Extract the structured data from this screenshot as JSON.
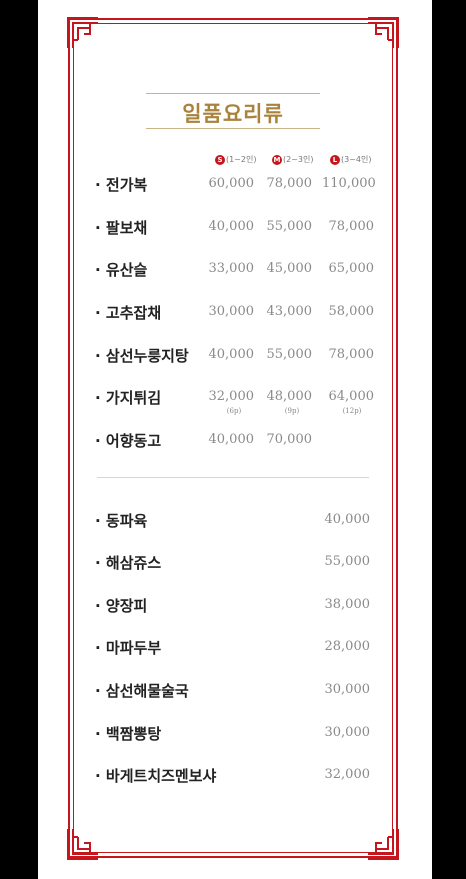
{
  "title": "일품요리류",
  "size_headers": [
    {
      "badge": "S",
      "text": "(1~2인)"
    },
    {
      "badge": "M",
      "text": "(2~3인)"
    },
    {
      "badge": "L",
      "text": "(3~4인)"
    }
  ],
  "sized_dishes": [
    {
      "name": "· 전가복",
      "s": "60,000",
      "m": "78,000",
      "l": "110,000"
    },
    {
      "name": "· 팔보채",
      "s": "40,000",
      "m": "55,000",
      "l": "78,000"
    },
    {
      "name": "· 유산슬",
      "s": "33,000",
      "m": "45,000",
      "l": "65,000"
    },
    {
      "name": "· 고추잡채",
      "s": "30,000",
      "m": "43,000",
      "l": "58,000"
    },
    {
      "name": "· 삼선누룽지탕",
      "s": "40,000",
      "m": "55,000",
      "l": "78,000"
    },
    {
      "name": "· 가지튀김",
      "s": "32,000",
      "m": "48,000",
      "l": "64,000",
      "s_sub": "(6p)",
      "m_sub": "(9p)",
      "l_sub": "(12p)"
    },
    {
      "name": "· 어향동고",
      "s": "40,000",
      "m": "70,000",
      "l": ""
    }
  ],
  "single_dishes": [
    {
      "name": "· 동파육",
      "price": "40,000"
    },
    {
      "name": "· 해삼쥬스",
      "price": "55,000"
    },
    {
      "name": "· 양장피",
      "price": "38,000"
    },
    {
      "name": "· 마파두부",
      "price": "28,000"
    },
    {
      "name": "· 삼선해물술국",
      "price": "30,000"
    },
    {
      "name": "· 백짬뽕탕",
      "price": "30,000"
    },
    {
      "name": "· 바게트치즈멘보샤",
      "price": "32,000"
    }
  ],
  "colors": {
    "frame": "#c5161d",
    "title": "#a9823c",
    "price": "#8a8a8a"
  }
}
